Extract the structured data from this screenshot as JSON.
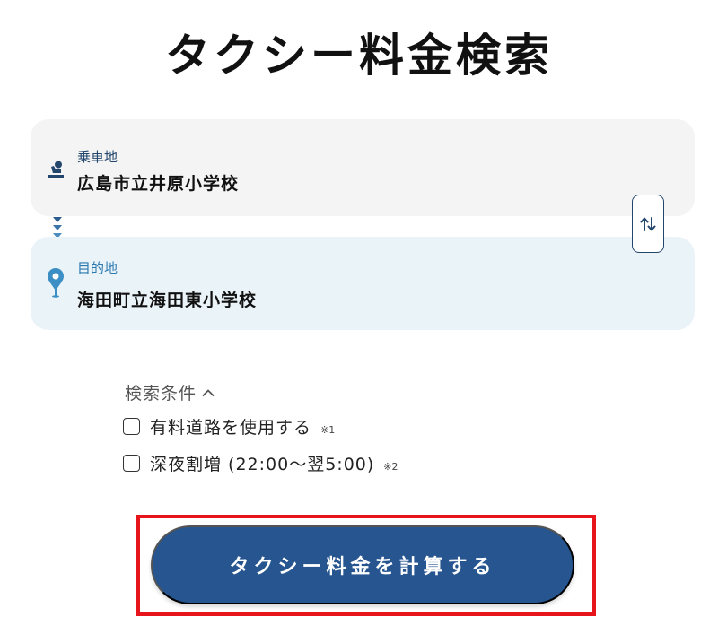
{
  "page": {
    "title": "タクシー料金検索"
  },
  "pickup": {
    "label": "乗車地",
    "value": "広島市立井原小学校",
    "icon": "person-seat-icon"
  },
  "destination": {
    "label": "目的地",
    "value": "海田町立海田東小学校",
    "icon": "map-pin-icon"
  },
  "swap": {
    "icon": "swap-arrows-icon"
  },
  "conditions": {
    "header": "検索条件",
    "options": [
      {
        "label": "有料道路を使用する",
        "note": "※1",
        "checked": false
      },
      {
        "label": "深夜割増 (22:00～翌5:00)",
        "note": "※2",
        "checked": false
      }
    ]
  },
  "actions": {
    "calculate_label": "タクシー料金を計算する"
  },
  "colors": {
    "navy": "#23466c",
    "button": "#265590",
    "highlight": "#e8141b",
    "pin": "#3c8fc4"
  }
}
